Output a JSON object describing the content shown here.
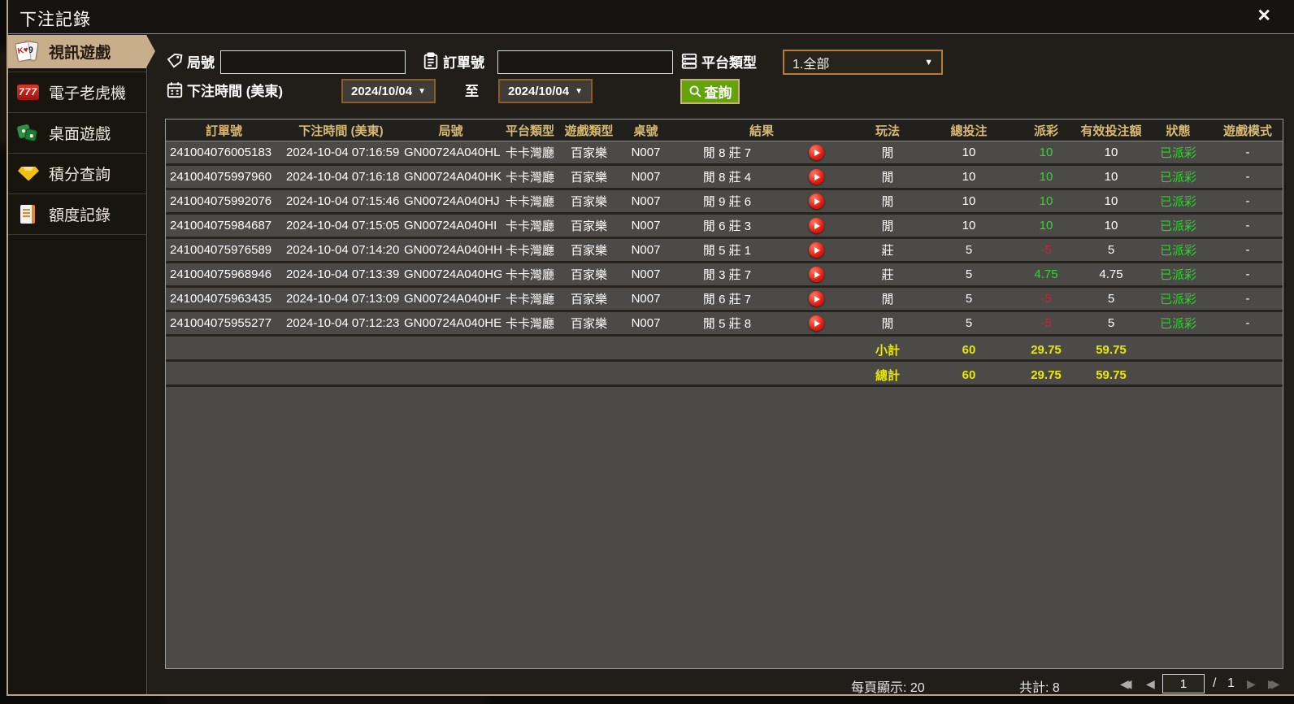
{
  "window": {
    "title": "下注記錄",
    "close_glyph": "✕"
  },
  "sidebar": {
    "items": [
      {
        "label": "視訊遊戲",
        "icon": "cards-icon",
        "active": true
      },
      {
        "label": "電子老虎機",
        "icon": "slot-777-icon",
        "active": false
      },
      {
        "label": "桌面遊戲",
        "icon": "dice-icon",
        "active": false
      },
      {
        "label": "積分查詢",
        "icon": "gem-icon",
        "active": false
      },
      {
        "label": "額度記錄",
        "icon": "document-icon",
        "active": false
      }
    ]
  },
  "filters": {
    "round_label": "局號",
    "round_value": "",
    "order_label": "訂單號",
    "order_value": "",
    "platform_label": "平台類型",
    "platform_value": "1.全部",
    "time_label": "下注時間 (美東)",
    "date_from": "2024/10/04",
    "to_label": "至",
    "date_to": "2024/10/04",
    "search_label": "查詢",
    "caret": "▼"
  },
  "table": {
    "headers": [
      "訂單號",
      "下注時間 (美東)",
      "局號",
      "平台類型",
      "遊戲類型",
      "桌號",
      "結果",
      "玩法",
      "總投注",
      "派彩",
      "有效投注額",
      "狀態",
      "遊戲模式"
    ],
    "rows": [
      {
        "order_no": "241004076005183",
        "bet_time": "2024-10-04 07:16:59",
        "round_no": "GN00724A040HL",
        "platform": "卡卡灣廳",
        "game_type": "百家樂",
        "table_no": "N007",
        "result": "閒 8 莊 7",
        "play": "閒",
        "total_bet": "10",
        "payout": "10",
        "payout_state": "pos",
        "valid_bet": "10",
        "status": "已派彩",
        "mode": "-"
      },
      {
        "order_no": "241004075997960",
        "bet_time": "2024-10-04 07:16:18",
        "round_no": "GN00724A040HK",
        "platform": "卡卡灣廳",
        "game_type": "百家樂",
        "table_no": "N007",
        "result": "閒 8 莊 4",
        "play": "閒",
        "total_bet": "10",
        "payout": "10",
        "payout_state": "pos",
        "valid_bet": "10",
        "status": "已派彩",
        "mode": "-"
      },
      {
        "order_no": "241004075992076",
        "bet_time": "2024-10-04 07:15:46",
        "round_no": "GN00724A040HJ",
        "platform": "卡卡灣廳",
        "game_type": "百家樂",
        "table_no": "N007",
        "result": "閒 9 莊 6",
        "play": "閒",
        "total_bet": "10",
        "payout": "10",
        "payout_state": "pos",
        "valid_bet": "10",
        "status": "已派彩",
        "mode": "-"
      },
      {
        "order_no": "241004075984687",
        "bet_time": "2024-10-04 07:15:05",
        "round_no": "GN00724A040HI",
        "platform": "卡卡灣廳",
        "game_type": "百家樂",
        "table_no": "N007",
        "result": "閒 6 莊 3",
        "play": "閒",
        "total_bet": "10",
        "payout": "10",
        "payout_state": "pos",
        "valid_bet": "10",
        "status": "已派彩",
        "mode": "-"
      },
      {
        "order_no": "241004075976589",
        "bet_time": "2024-10-04 07:14:20",
        "round_no": "GN00724A040HH",
        "platform": "卡卡灣廳",
        "game_type": "百家樂",
        "table_no": "N007",
        "result": "閒 5 莊 1",
        "play": "莊",
        "total_bet": "5",
        "payout": "-5",
        "payout_state": "neg",
        "valid_bet": "5",
        "status": "已派彩",
        "mode": "-"
      },
      {
        "order_no": "241004075968946",
        "bet_time": "2024-10-04 07:13:39",
        "round_no": "GN00724A040HG",
        "platform": "卡卡灣廳",
        "game_type": "百家樂",
        "table_no": "N007",
        "result": "閒 3 莊 7",
        "play": "莊",
        "total_bet": "5",
        "payout": "4.75",
        "payout_state": "pos",
        "valid_bet": "4.75",
        "status": "已派彩",
        "mode": "-"
      },
      {
        "order_no": "241004075963435",
        "bet_time": "2024-10-04 07:13:09",
        "round_no": "GN00724A040HF",
        "platform": "卡卡灣廳",
        "game_type": "百家樂",
        "table_no": "N007",
        "result": "閒 6 莊 7",
        "play": "閒",
        "total_bet": "5",
        "payout": "-5",
        "payout_state": "neg",
        "valid_bet": "5",
        "status": "已派彩",
        "mode": "-"
      },
      {
        "order_no": "241004075955277",
        "bet_time": "2024-10-04 07:12:23",
        "round_no": "GN00724A040HE",
        "platform": "卡卡灣廳",
        "game_type": "百家樂",
        "table_no": "N007",
        "result": "閒 5 莊 8",
        "play": "閒",
        "total_bet": "5",
        "payout": "-5",
        "payout_state": "neg",
        "valid_bet": "5",
        "status": "已派彩",
        "mode": "-"
      }
    ],
    "subtotal": {
      "label": "小計",
      "total_bet": "60",
      "payout": "29.75",
      "valid_bet": "59.75"
    },
    "total": {
      "label": "總計",
      "total_bet": "60",
      "payout": "29.75",
      "valid_bet": "59.75"
    }
  },
  "footer": {
    "per_page": "每頁顯示: 20",
    "record_total": "共計: 8",
    "page_value": "1",
    "page_separator": "/",
    "page_total": "1"
  },
  "colors": {
    "selected_tan": "#c9ae8c",
    "header_gold": "#d8ba74",
    "positive_green": "#35d435",
    "status_green": "#2fd12f",
    "negative_red": "#c2273c",
    "sum_yellow": "#e8e800",
    "search_green": "#63a30c",
    "date_border_brown": "#8f5c22",
    "dropdown_border_orange": "#b97b2d"
  }
}
